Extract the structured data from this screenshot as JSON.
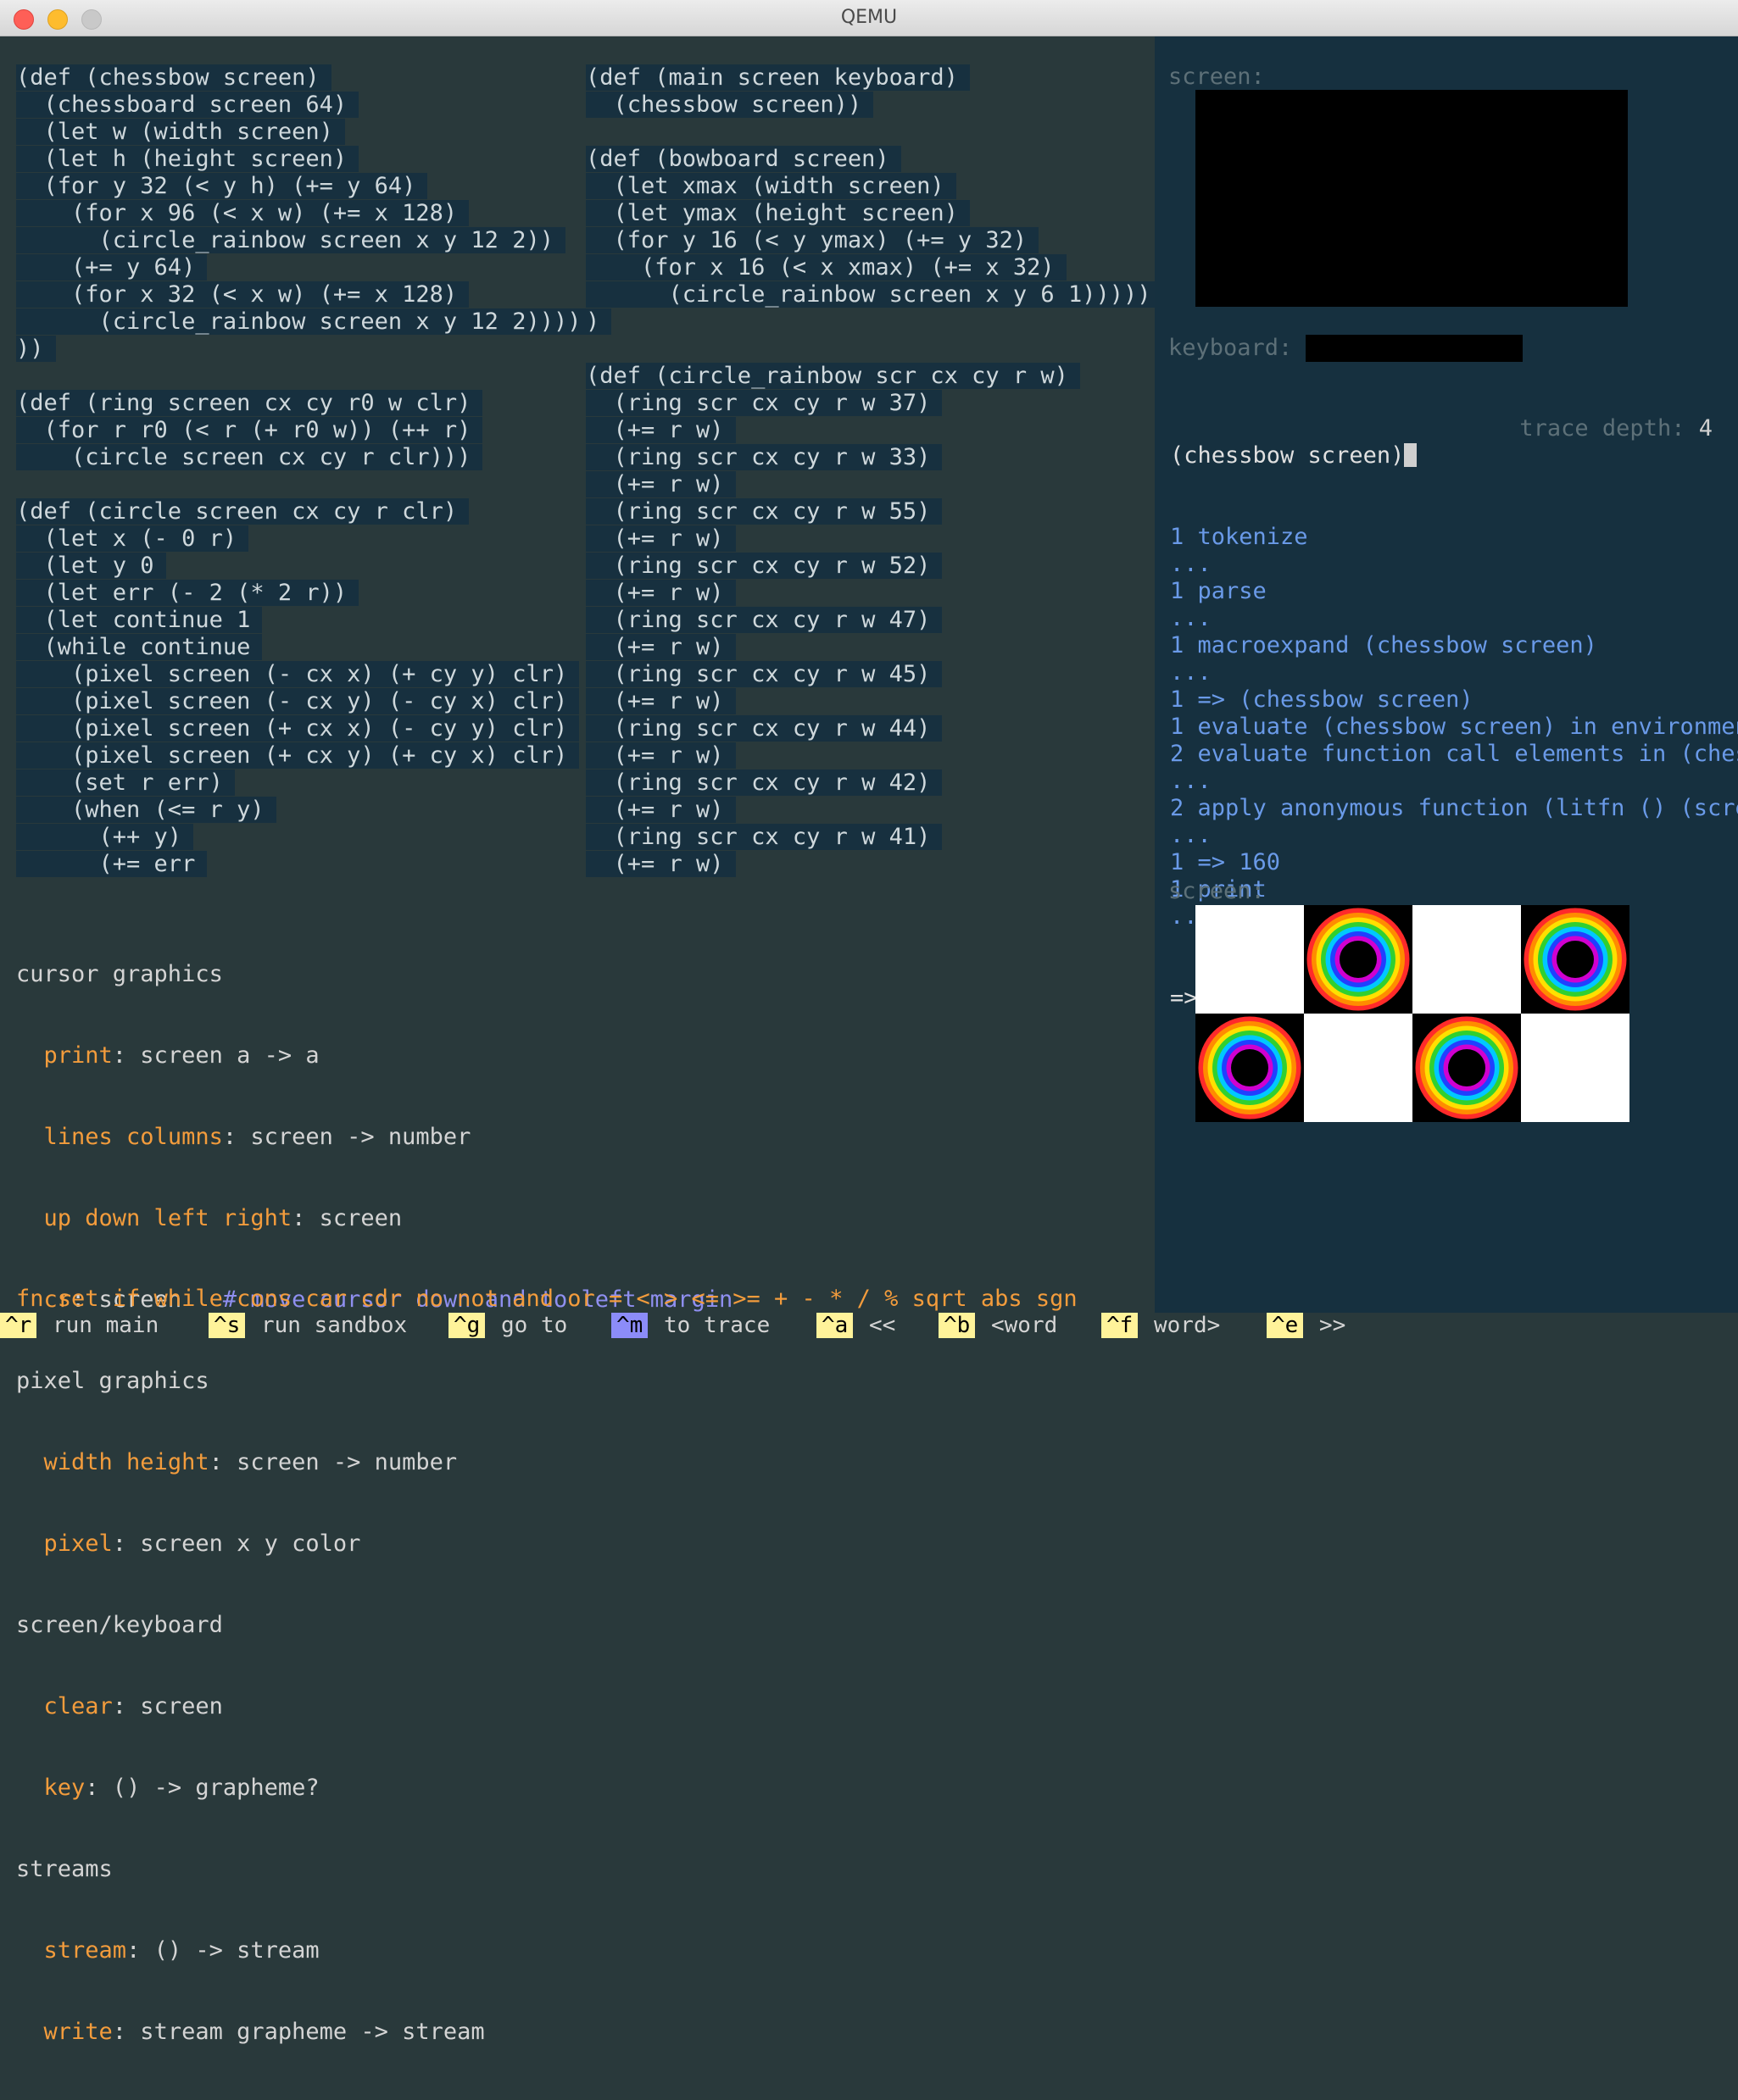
{
  "window": {
    "title": "QEMU"
  },
  "definitions_col1": [
    "(def (chessbow screen)",
    "  (chessboard screen 64)",
    "  (let w (width screen)",
    "  (let h (height screen)",
    "  (for y 32 (< y h) (+= y 64)",
    "    (for x 96 (< x w) (+= x 128)",
    "      (circle_rainbow screen x y 12 2))",
    "    (+= y 64)",
    "    (for x 32 (< x w) (+= x 128)",
    "      (circle_rainbow screen x y 12 2))))",
    "))",
    "",
    "(def (ring screen cx cy r0 w clr)",
    "  (for r r0 (< r (+ r0 w)) (++ r)",
    "    (circle screen cx cy r clr)))",
    "",
    "(def (circle screen cx cy r clr)",
    "  (let x (- 0 r)",
    "  (let y 0",
    "  (let err (- 2 (* 2 r))",
    "  (let continue 1",
    "  (while continue",
    "    (pixel screen (- cx x) (+ cy y) clr)",
    "    (pixel screen (- cx y) (- cy x) clr)",
    "    (pixel screen (+ cx x) (- cy y) clr)",
    "    (pixel screen (+ cx y) (+ cy x) clr)",
    "    (set r err)",
    "    (when (<= r y)",
    "      (++ y)",
    "      (+= err"
  ],
  "definitions_col2": [
    "(def (main screen keyboard)",
    "  (chessbow screen))",
    "",
    "(def (bowboard screen)",
    "  (let xmax (width screen)",
    "  (let ymax (height screen)",
    "  (for y 16 (< y ymax) (+= y 32)",
    "    (for x 16 (< x xmax) (+= x 32)",
    "      (circle_rainbow screen x y 6 1)))))",
    ")",
    "",
    "(def (circle_rainbow scr cx cy r w)",
    "  (ring scr cx cy r w 37)",
    "  (+= r w)",
    "  (ring scr cx cy r w 33)",
    "  (+= r w)",
    "  (ring scr cx cy r w 55)",
    "  (+= r w)",
    "  (ring scr cx cy r w 52)",
    "  (+= r w)",
    "  (ring scr cx cy r w 47)",
    "  (+= r w)",
    "  (ring scr cx cy r w 45)",
    "  (+= r w)",
    "  (ring scr cx cy r w 44)",
    "  (+= r w)",
    "  (ring scr cx cy r w 42)",
    "  (+= r w)",
    "  (ring scr cx cy r w 41)",
    "  (+= r w)"
  ],
  "docs": {
    "cursor_heading": "cursor graphics",
    "print_kw": "print",
    "print_sig": ": screen a -> a",
    "lines_kw": "lines columns",
    "lines_sig": ": screen -> number",
    "updown_kw": "up down left right",
    "updown_sig": ": screen",
    "cr_kw": "cr",
    "cr_sig": ": screen",
    "cr_comment": "# move cursor down and to left margin",
    "pixel_heading": "pixel graphics",
    "wh_kw": "width height",
    "wh_sig": ": screen -> number",
    "pixel_kw": "pixel",
    "pixel_sig": ": screen x y color",
    "sk_heading": "screen/keyboard",
    "clear_kw": "clear",
    "clear_sig": ": screen",
    "key_kw": "key",
    "key_sig": ": () -> grapheme?",
    "streams_heading": "streams",
    "stream_kw": "stream",
    "stream_sig": ": () -> stream",
    "write_kw": "write",
    "write_sig": ": stream grapheme -> stream",
    "builtins": "fn set if while cons car cdr no not and or = < > <= >= + - * / % sqrt abs sgn"
  },
  "sandbox": {
    "screen_label": "screen:",
    "keyboard_label": "keyboard:",
    "input": "(chessbow screen)",
    "trace_depth_label": "trace depth:",
    "trace_depth_value": "4",
    "trace_lines": [
      "1 tokenize",
      "...",
      "1 parse",
      "...",
      "1 macroexpand (chessbow screen)",
      "...",
      "1 => (chessbow screen)",
      "1 evaluate (chessbow screen) in environmen",
      "2 evaluate function call elements in (ches",
      "...",
      "2 apply anonymous function (litfn () (scre",
      "...",
      "1 => 160",
      "1 print",
      "..."
    ],
    "result": "=> 160",
    "output_screen_label": "screen:",
    "output_grid": [
      [
        0,
        1,
        0,
        1
      ],
      [
        1,
        0,
        1,
        0
      ]
    ]
  },
  "menu": [
    {
      "key": "^r",
      "label": "run main"
    },
    {
      "key": "^s",
      "label": "run sandbox"
    },
    {
      "key": "^g",
      "label": "go to"
    },
    {
      "key": "^m",
      "label": "to trace"
    },
    {
      "key": "^a",
      "label": "<<"
    },
    {
      "key": "^b",
      "label": "<word"
    },
    {
      "key": "^f",
      "label": "word>"
    },
    {
      "key": "^e",
      "label": ">>"
    }
  ],
  "colors": {
    "ring_colors": [
      "#ff2a2a",
      "#ff8c00",
      "#ffe000",
      "#30d030",
      "#00c8ff",
      "#2040ff",
      "#d000d0"
    ]
  }
}
